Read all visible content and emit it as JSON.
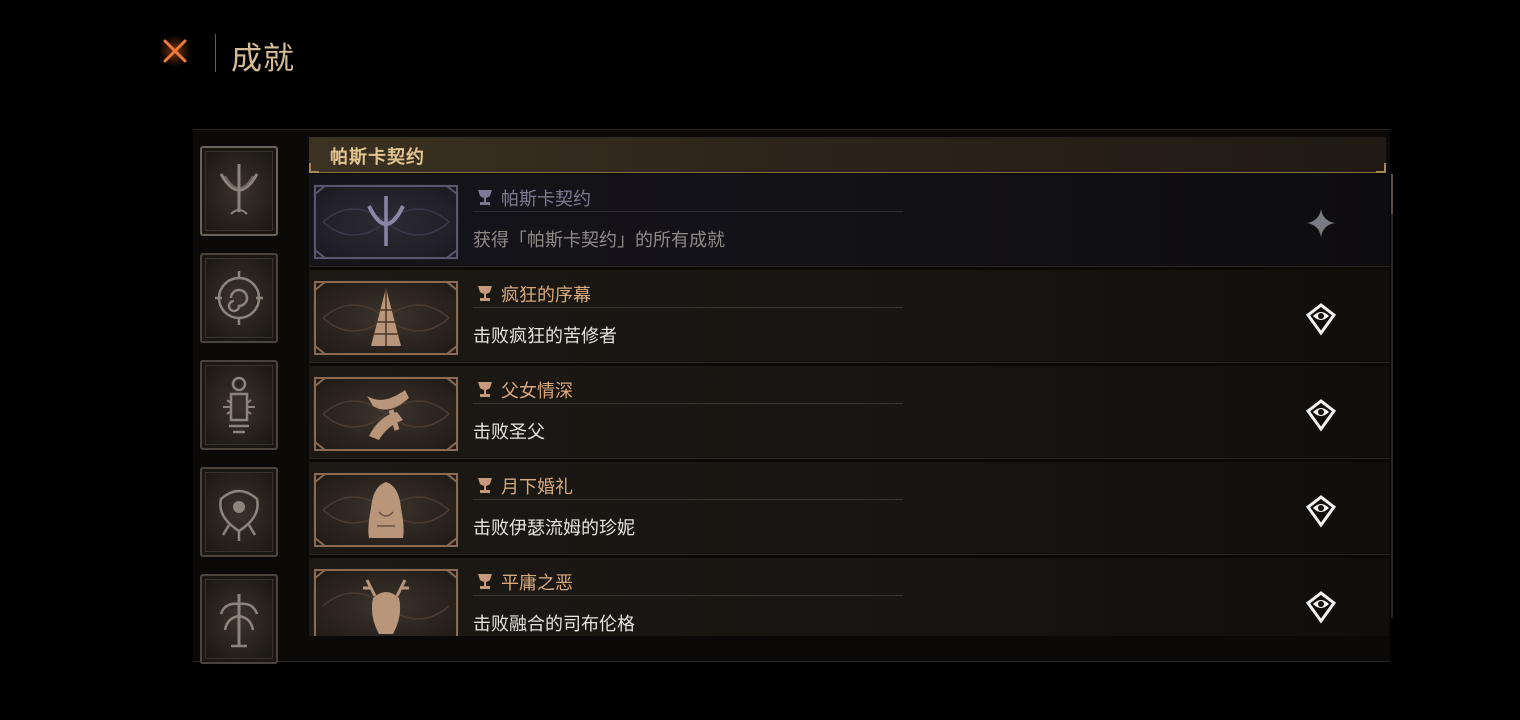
{
  "header": {
    "title": "成就",
    "close_icon": "close-x-icon"
  },
  "sidebar": {
    "categories": [
      {
        "icon": "crescent-moon-sigil-icon",
        "active": true
      },
      {
        "icon": "spiral-compass-sigil-icon",
        "active": false
      },
      {
        "icon": "lantern-sigil-icon",
        "active": false
      },
      {
        "icon": "eye-sigil-icon",
        "active": false
      },
      {
        "icon": "tree-sigil-icon",
        "active": false
      }
    ]
  },
  "section": {
    "title": "帕斯卡契约"
  },
  "achievements": [
    {
      "name": "帕斯卡契约",
      "description": "获得「帕斯卡契约」的所有成就",
      "icon": "crescent-moon-icon",
      "status_icon": "sparkle-icon",
      "unlocked": false
    },
    {
      "name": "疯狂的序幕",
      "description": "击败疯狂的苦修者",
      "icon": "spiked-tree-icon",
      "status_icon": "platform-badge-icon",
      "unlocked": true
    },
    {
      "name": "父女情深",
      "description": "击败圣父",
      "icon": "crossed-arms-icon",
      "status_icon": "platform-badge-icon",
      "unlocked": true
    },
    {
      "name": "月下婚礼",
      "description": "击败伊瑟流姆的珍妮",
      "icon": "veiled-figure-icon",
      "status_icon": "platform-badge-icon",
      "unlocked": true
    },
    {
      "name": "平庸之恶",
      "description": "击败融合的司布伦格",
      "icon": "antlered-beast-icon",
      "status_icon": "platform-badge-icon",
      "unlocked": true
    }
  ],
  "colors": {
    "accent": "#e3c491",
    "unlocked_name": "#d8a97c",
    "locked_name": "#7f7b93",
    "close": "#e0642a"
  }
}
